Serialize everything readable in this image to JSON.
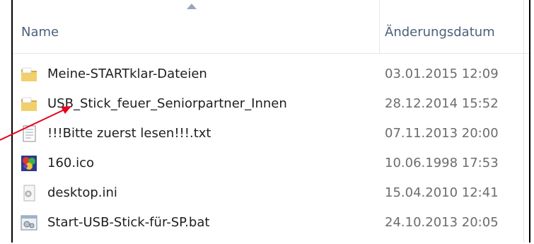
{
  "header": {
    "name_label": "Name",
    "date_label": "Änderungsdatum"
  },
  "files": [
    {
      "name": "Meine-STARTklar-Dateien",
      "date": "03.01.2015 12:09",
      "icon": "folder-icon"
    },
    {
      "name": "USB_Stick_feuer_Seniorpartner_Innen",
      "date": "28.12.2014 15:52",
      "icon": "folder-icon"
    },
    {
      "name": "!!!Bitte zuerst lesen!!!.txt",
      "date": "07.11.2013 20:00",
      "icon": "text-file-icon"
    },
    {
      "name": "160.ico",
      "date": "10.06.1998 17:53",
      "icon": "ico-image-icon"
    },
    {
      "name": "desktop.ini",
      "date": "15.04.2010 12:41",
      "icon": "settings-file-icon"
    },
    {
      "name": "Start-USB-Stick-für-SP.bat",
      "date": "24.10.2013 20:05",
      "icon": "batch-file-icon"
    }
  ],
  "colors": {
    "annotation_arrow": "#e8001c",
    "header_text": "#4c607a",
    "folder": "#e8c35a"
  }
}
